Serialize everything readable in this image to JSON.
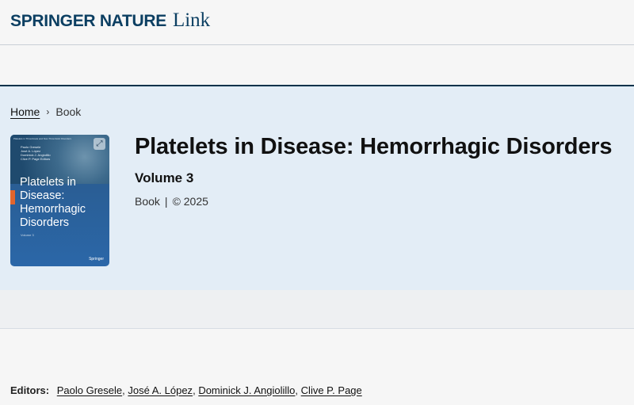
{
  "header": {
    "brand_main": "SPRINGER NATURE",
    "brand_sub": "Link"
  },
  "breadcrumb": {
    "home": "Home",
    "separator": "›",
    "current": "Book"
  },
  "cover": {
    "series": "Platelets in Thrombosis and Non-Thrombotic Disorders",
    "editors": [
      "Paolo Gresele",
      "José A. López",
      "Dominick J. Angiolillo",
      "Clive P. Page  Editors"
    ],
    "title": "Platelets in Disease: Hemorrhagic Disorders",
    "volume": "Volume 3",
    "publisher": "Springer",
    "expand_icon": "expand-icon"
  },
  "book": {
    "title": "Platelets in Disease: Hemorrhagic Disorders",
    "volume": "Volume 3",
    "type": "Book",
    "separator": "|",
    "copyright": "© 2025"
  },
  "editors": {
    "label": "Editors:",
    "names": [
      "Paolo Gresele",
      "José A. López",
      "Dominick J. Angiolillo",
      "Clive P. Page"
    ],
    "separator": ","
  },
  "colors": {
    "brand": "#0c3f62",
    "hero_bg": "#e3edf6",
    "accent": "#e2652d"
  }
}
